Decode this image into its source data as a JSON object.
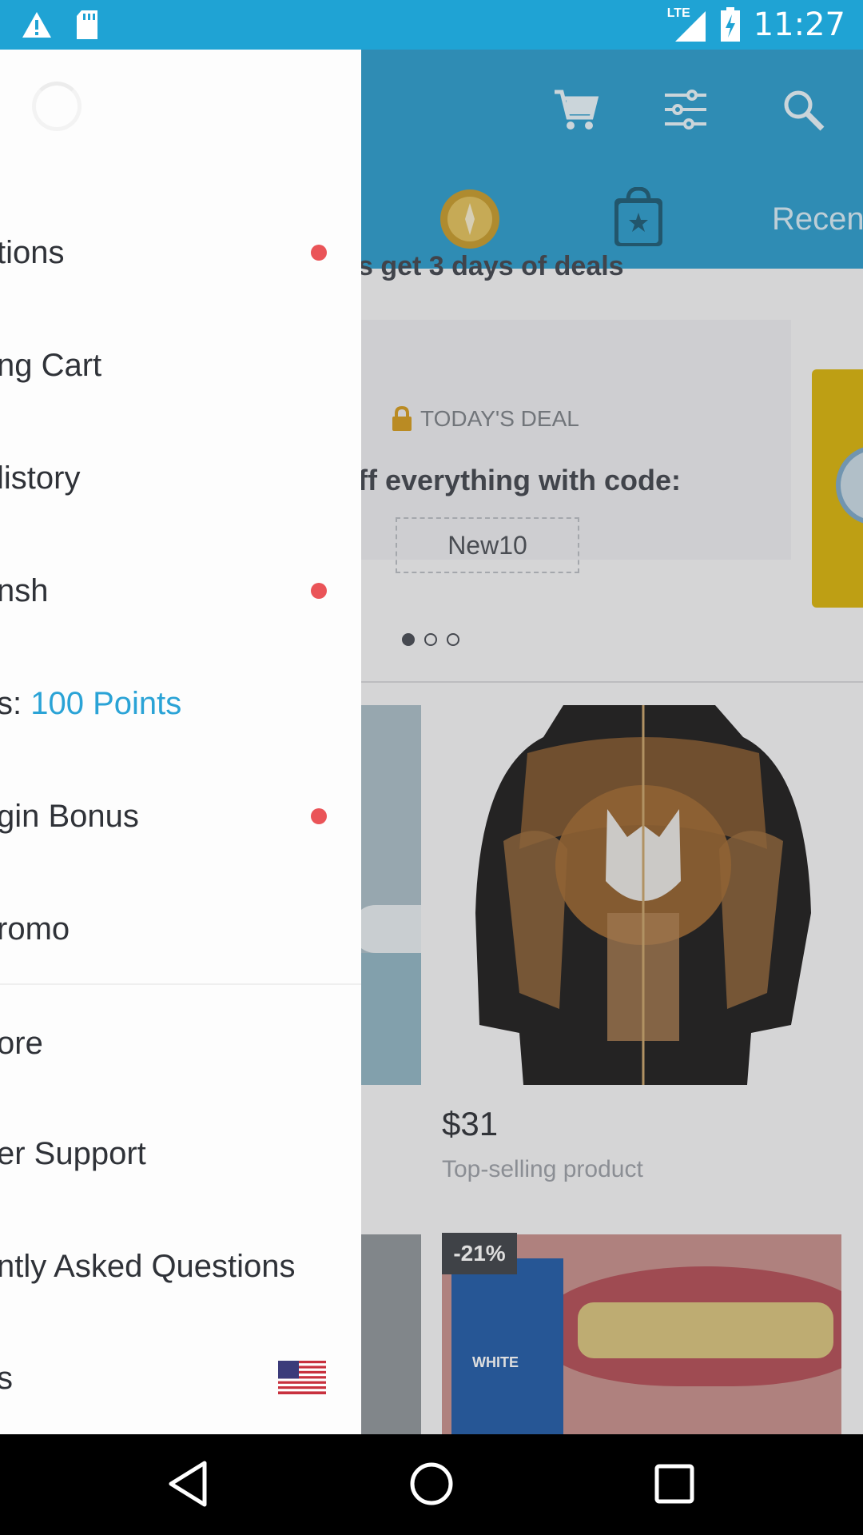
{
  "status_bar": {
    "time": "11:27",
    "network": "LTE",
    "icons": [
      "warning-icon",
      "sd-card-icon",
      "signal-icon",
      "battery-charging-icon"
    ]
  },
  "header": {
    "icons": [
      "cart-icon",
      "filter-icon",
      "search-icon"
    ],
    "tabs": {
      "recent_label": "Recen"
    }
  },
  "main": {
    "promo_text": "s get 3 days of deals",
    "deal": {
      "label": "TODAY'S DEAL",
      "text": "ff everything with code:",
      "code": "New10"
    },
    "carousel_dots": 3,
    "product": {
      "price": "$31",
      "subtitle": "Top-selling product"
    },
    "discount_badge": "-21%",
    "teeth_box_text": "WHITE"
  },
  "drawer": {
    "items": [
      {
        "label": "tions",
        "dot": true
      },
      {
        "label": "ng Cart",
        "dot": false
      },
      {
        "label": "listory",
        "dot": false
      },
      {
        "label": "nsh",
        "dot": true
      },
      {
        "label_prefix": "s: ",
        "points": "100 Points",
        "dot": false
      },
      {
        "label": "gin Bonus",
        "dot": true
      },
      {
        "label": "romo",
        "dot": false
      },
      {
        "label": "ore",
        "dot": false
      },
      {
        "label": "er Support",
        "dot": false
      },
      {
        "label": "ntly Asked Questions",
        "dot": false
      },
      {
        "label": "s",
        "dot": false
      }
    ],
    "flag_icon": "us-flag-icon"
  },
  "nav_bar": {
    "icons": [
      "back-icon",
      "home-icon",
      "recents-icon"
    ]
  },
  "colors": {
    "status_bar": "#1fa3d4",
    "header": "#2a9ccc",
    "accent": "#2aa3d6",
    "notification_dot": "#ea5458"
  }
}
